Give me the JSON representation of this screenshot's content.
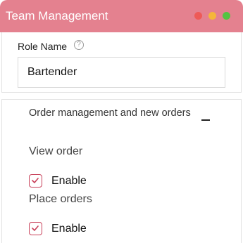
{
  "window": {
    "title": "Team Management",
    "controls": {
      "close_color": "#ee5a57",
      "minimize_color": "#f5b63a",
      "maximize_color": "#55c441"
    },
    "accent": "#e4818f"
  },
  "role": {
    "label": "Role Name",
    "help_icon": "question-circle-icon",
    "help_glyph": "?",
    "value": "Bartender"
  },
  "permissions": {
    "section_title": "Order management and new orders",
    "collapse_icon": "minus-icon",
    "items": [
      {
        "label": "View order",
        "enable_label": "Enable",
        "checked": true
      },
      {
        "label": "Place orders",
        "enable_label": "Enable",
        "checked": true
      }
    ]
  }
}
